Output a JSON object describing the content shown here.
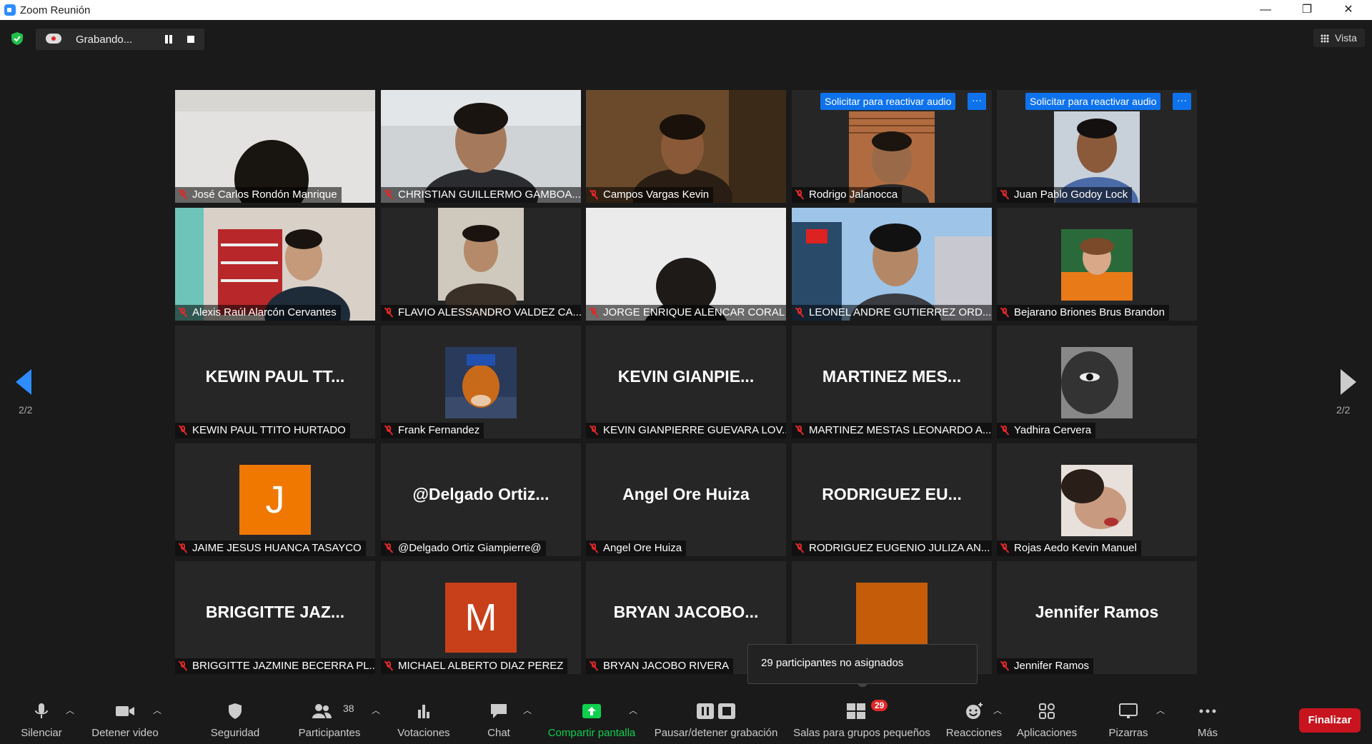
{
  "window": {
    "title": "Zoom Reunión",
    "minimize": "—",
    "restore": "❐",
    "close": "✕"
  },
  "recording": {
    "status": "Grabando..."
  },
  "view_button": {
    "label": "Vista"
  },
  "pagination": {
    "left": "2/2",
    "right": "2/2"
  },
  "ask_unmute": "Solicitar para reactivar audio",
  "more_dots": "···",
  "participants": [
    {
      "name": "José Carlos Rondón Manrique"
    },
    {
      "name": "CHRISTIAN GUILLERMO GAMBOA..."
    },
    {
      "name": "Campos Vargas Kevin"
    },
    {
      "name": "Rodrigo Jalanocca"
    },
    {
      "name": "Juan Pablo Godoy Lock"
    },
    {
      "name": "Alexis Raúl Alarcón Cervantes"
    },
    {
      "name": "FLAVIO ALESSANDRO VALDEZ CA..."
    },
    {
      "name": "JORGE ENRIQUE ALENCAR CORAL"
    },
    {
      "name": "LEONEL ANDRE GUTIERREZ ORD..."
    },
    {
      "name": "Bejarano Briones Brus Brandon"
    },
    {
      "name": "KEWIN PAUL TTITO HURTADO",
      "display": "KEWIN  PAUL  TT..."
    },
    {
      "name": "Frank Fernandez"
    },
    {
      "name": "KEVIN GIANPIERRE GUEVARA LOV...",
      "display": "KEVIN  GIANPIE..."
    },
    {
      "name": "MARTINEZ MESTAS LEONARDO A...",
      "display": "MARTINEZ  MES..."
    },
    {
      "name": "Yadhira Cervera"
    },
    {
      "name": "JAIME JESUS HUANCA TASAYCO",
      "avatar": "J",
      "avatar_color": "#f07800"
    },
    {
      "name": "@Delgado Ortiz Giampierre@",
      "display": "@Delgado  Ortiz..."
    },
    {
      "name": "Angel Ore Huiza",
      "display": "Angel Ore Huiza"
    },
    {
      "name": "RODRIGUEZ EUGENIO JULIZA AN...",
      "display": "RODRIGUEZ  EU..."
    },
    {
      "name": "Rojas Aedo Kevin Manuel"
    },
    {
      "name": "BRIGGITTE JAZMINE BECERRA PL...",
      "display": "BRIGGITTE  JAZ..."
    },
    {
      "name": "MICHAEL ALBERTO DIAZ PEREZ",
      "avatar": "M",
      "avatar_color": "#c8401a"
    },
    {
      "name": "BRYAN JACOBO RIVERA",
      "display": "BRYAN  JACOBO..."
    },
    {
      "name": "",
      "avatar_color": "#c45c0a"
    },
    {
      "name": "Jennifer Ramos",
      "display": "Jennifer Ramos"
    }
  ],
  "tooltip": {
    "text": "29 participantes no asignados"
  },
  "toolbar": {
    "mute": "Silenciar",
    "stop_video": "Detener video",
    "security": "Seguridad",
    "participants": "Participantes",
    "participants_count": "38",
    "polls": "Votaciones",
    "chat": "Chat",
    "share": "Compartir pantalla",
    "record": "Pausar/detener grabación",
    "breakout": "Salas para grupos pequeños",
    "breakout_badge": "29",
    "reactions": "Reacciones",
    "apps": "Aplicaciones",
    "whiteboards": "Pizarras",
    "more": "Más",
    "end": "Finalizar"
  },
  "colors": {
    "accent": "#2d8cff",
    "share_green": "#0ecf4e",
    "end_red": "#c8141e",
    "muted_red": "#e02828"
  }
}
